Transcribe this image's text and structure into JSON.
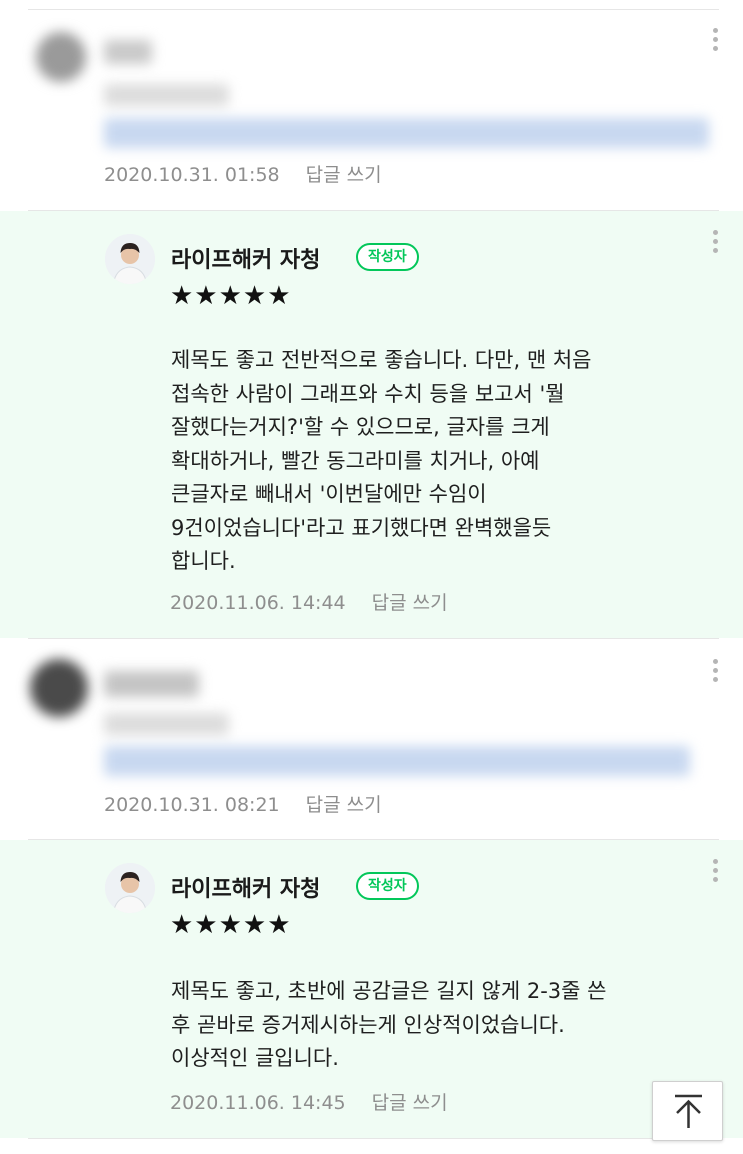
{
  "comments": [
    {
      "type": "visitor",
      "blurred": true,
      "date": "2020.10.31. 01:58",
      "reply_label": "답글 쓰기"
    },
    {
      "type": "author_reply",
      "author": "라이프해커 자청",
      "badge": "작성자",
      "stars": "★★★★★",
      "text": "제목도 좋고 전반적으로 좋습니다. 다만, 맨 처음\n접속한 사람이 그래프와 수치 등을 보고서 '뭘\n잘했다는거지?'할 수 있으므로, 글자를 크게\n확대하거나, 빨간 동그라미를 치거나, 아예\n큰글자로 빼내서 '이번달에만 수임이\n9건이었습니다'라고 표기했다면 완벽했을듯\n합니다.",
      "date": "2020.11.06. 14:44",
      "reply_label": "답글 쓰기"
    },
    {
      "type": "visitor",
      "blurred": true,
      "date": "2020.10.31. 08:21",
      "reply_label": "답글 쓰기"
    },
    {
      "type": "author_reply",
      "author": "라이프해커 자청",
      "badge": "작성자",
      "stars": "★★★★★",
      "text": "제목도 좋고, 초반에 공감글은 길지 않게 2-3줄 쓴\n후 곧바로 증거제시하는게 인상적이었습니다.\n이상적인 글입니다.",
      "date": "2020.11.06. 14:45",
      "reply_label": "답글 쓰기"
    }
  ],
  "icons": {
    "more": "kebab-menu-icon",
    "scroll_top": "arrow-up-icon"
  },
  "colors": {
    "author_reply_bg": "#f0fcf4",
    "badge_green": "#03c75a",
    "meta_gray": "#8e8e8e"
  }
}
